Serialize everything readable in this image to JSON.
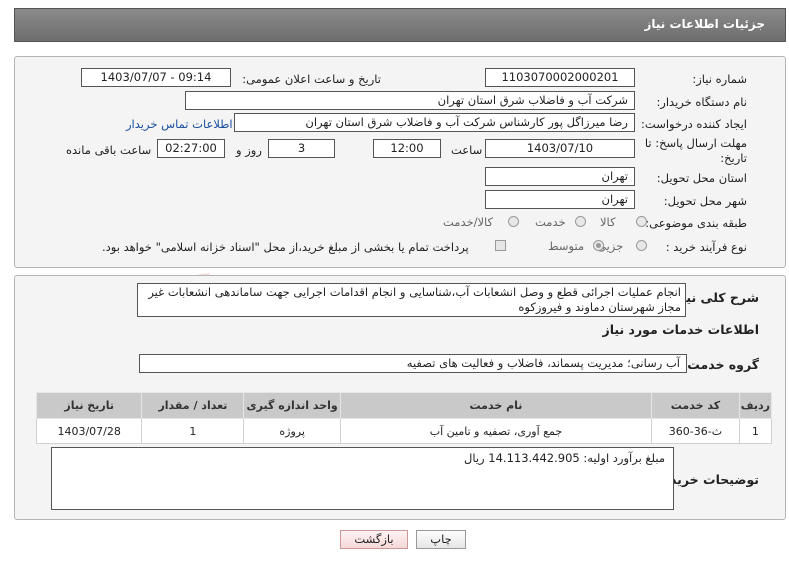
{
  "header": {
    "title": "جزئیات اطلاعات نیاز"
  },
  "form": {
    "need_number_label": "شماره نیاز:",
    "need_number": "1103070002000201",
    "announce_label": "تاریخ و ساعت اعلان عمومی:",
    "announce_value": "1403/07/07 - 09:14",
    "buyer_org_label": "نام دستگاه خریدار:",
    "buyer_org": "شرکت آب و فاضلاب شرق استان تهران",
    "creator_label": "ایجاد کننده درخواست:",
    "creator": "رضا میرزاگل پور کارشناس شرکت آب و فاضلاب شرق استان تهران",
    "contact_link": "اطلاعات تماس خریدار",
    "deadline_label": "مهلت ارسال پاسخ: تا تاریخ:",
    "deadline_date": "1403/07/10",
    "time_label": "ساعت",
    "deadline_time": "12:00",
    "days": "3",
    "days_label": "روز و",
    "remaining_time": "02:27:00",
    "remaining_label": "ساعت باقی مانده",
    "province_label": "استان محل تحویل:",
    "province": "تهران",
    "city_label": "شهر محل تحویل:",
    "city": "تهران",
    "category_label": "طبقه بندی موضوعی:",
    "category_options": [
      "کالا",
      "خدمت",
      "کالا/خدمت"
    ],
    "purchase_type_label": "نوع فرآیند خرید :",
    "purchase_type_options": [
      "جزیی",
      "متوسط"
    ],
    "payment_note": "پرداخت تمام یا بخشی از مبلغ خرید،از محل \"اسناد خزانه اسلامی\" خواهد بود."
  },
  "description": {
    "label": "شرح کلی نیاز:",
    "text": "انجام عملیات اجرائی قطع و وصل انشعابات آب،شناسایی و انجام اقدامات اجرایی جهت ساماندهی انشعابات غیر مجاز شهرستان دماوند و فیروزکوه"
  },
  "services": {
    "section_title": "اطلاعات خدمات مورد نیاز",
    "group_label": "گروه خدمت:",
    "group_value": "آب رسانی؛ مدیریت پسماند، فاضلاب و فعالیت های تصفیه",
    "columns": [
      "ردیف",
      "کد خدمت",
      "نام خدمت",
      "واحد اندازه گیری",
      "تعداد / مقدار",
      "تاریخ نیاز"
    ],
    "rows": [
      [
        "1",
        "ث-36-360",
        "جمع آوری، تصفیه و تامین آب",
        "پروژه",
        "1",
        "1403/07/28"
      ]
    ]
  },
  "buyer_notes": {
    "label": "توضیحات خریدار:",
    "text": "مبلغ برآورد اولیه: 14.113.442.905  ریال"
  },
  "buttons": {
    "print": "چاپ",
    "back": "بازگشت"
  },
  "watermark": {
    "text": "AriaTender.neT"
  },
  "colors": {
    "header_bg": "#777777",
    "table_header_bg": "#c9c9c9",
    "link": "#1a4fa0",
    "back_button_bg": "#f5d8d8"
  }
}
